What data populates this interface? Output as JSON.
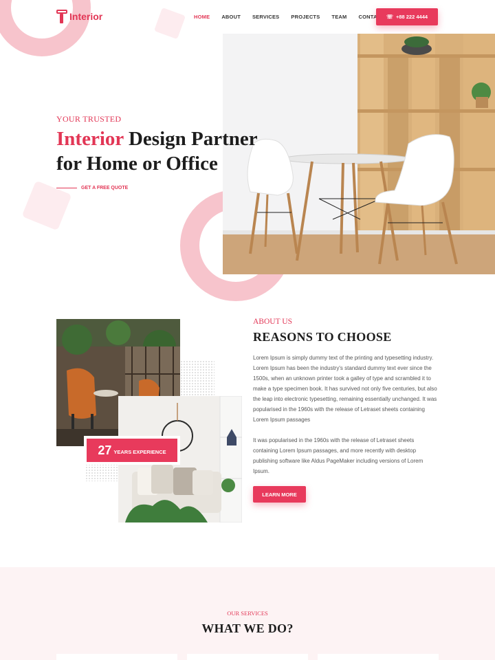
{
  "brand": {
    "name": "Interior",
    "accent_color": "#e23655"
  },
  "nav": {
    "items": [
      {
        "label": "HOME",
        "active": true
      },
      {
        "label": "ABOUT",
        "active": false
      },
      {
        "label": "SERVICES",
        "active": false
      },
      {
        "label": "PROJECTS",
        "active": false
      },
      {
        "label": "TEAM",
        "active": false
      },
      {
        "label": "CONTACT",
        "active": false
      }
    ],
    "phone_label": "+88 222 4444",
    "phone_icon": "phone-icon"
  },
  "hero": {
    "kicker": "YOUR TRUSTED",
    "title_accent": "Interior",
    "title_rest_line1": " Design Partner",
    "title_line2": "for Home or Office",
    "cta_label": "GET A FREE QUOTE"
  },
  "about": {
    "kicker": "ABOUT US",
    "title": "REASONS TO CHOOSE",
    "paragraph1": "Lorem Ipsum is simply dummy text of the printing and typesetting industry. Lorem Ipsum has been the industry's standard dummy text ever since the 1500s, when an unknown printer took a galley of type and scrambled it to make a type specimen book. It has survived not only five centuries, but also the leap into electronic typesetting, remaining essentially unchanged. It was popularised in the 1960s with the release of Letraset sheets containing Lorem Ipsum passages",
    "paragraph2": "It was popularised in the 1960s with the release of Letraset sheets containing Lorem Ipsum passages, and more recently with desktop publishing software like Aldus PageMaker including versions of Lorem Ipsum.",
    "experience_number": "27",
    "experience_label": "YEARS EXPERIENCE",
    "button_label": "LEARN MORE"
  },
  "services": {
    "kicker": "OUR SERVICES",
    "title": "WHAT WE DO?"
  }
}
